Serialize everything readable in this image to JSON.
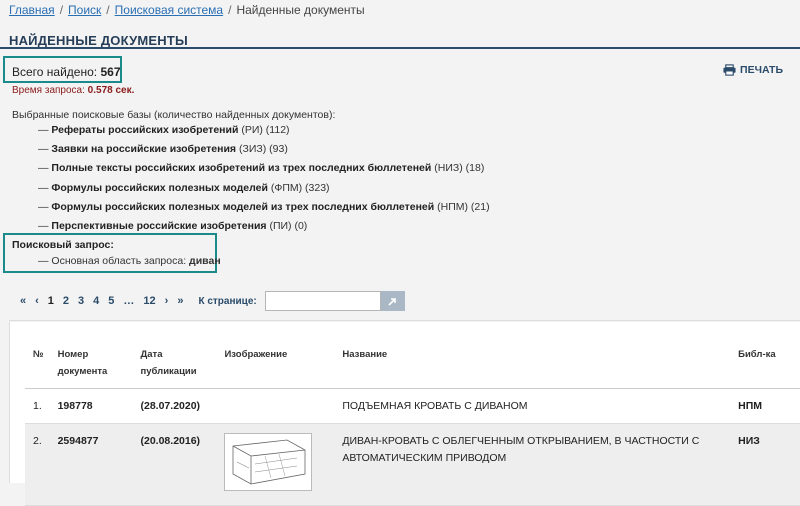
{
  "breadcrumb": {
    "home": "Главная",
    "search": "Поиск",
    "system": "Поисковая система",
    "current": "Найденные документы"
  },
  "page": {
    "title": "НАЙДЕННЫЕ ДОКУМЕНТЫ"
  },
  "summary": {
    "total_label": "Всего найдено:",
    "total_value": "567",
    "time_label": "Время запроса:",
    "time_value": "0.578 сек."
  },
  "print_label": "ПЕЧАТЬ",
  "databases": {
    "heading": "Выбранные поисковые базы (количество найденных документов):",
    "items": [
      {
        "name": "Рефераты российских изобретений",
        "count": "(РИ) (112)"
      },
      {
        "name": "Заявки на российские изобретения",
        "count": "(ЗИЗ) (93)"
      },
      {
        "name": "Полные тексты российских изобретений из трех последних бюллетеней",
        "count": "(НИЗ) (18)"
      },
      {
        "name": "Формулы российских полезных моделей",
        "count": "(ФПМ) (323)"
      },
      {
        "name": "Формулы российских полезных моделей из трех последних бюллетеней",
        "count": "(НПМ) (21)"
      },
      {
        "name": "Перспективные российские изобретения",
        "count": "(ПИ) (0)"
      }
    ]
  },
  "query": {
    "title": "Поисковый запрос:",
    "label": "— Основная область запроса:",
    "value": "диван"
  },
  "pagination": {
    "first": "«",
    "prev": "‹",
    "pages": [
      "1",
      "2",
      "3",
      "4",
      "5"
    ],
    "ellipsis": "…",
    "last_page": "12",
    "next": "›",
    "last": "»",
    "goto_label": "К странице:",
    "current": "1"
  },
  "table": {
    "headers": {
      "idx": "№",
      "number": "Номер документа",
      "date": "Дата публикации",
      "image": "Изображение",
      "name": "Название",
      "lib": "Библ-ка"
    },
    "rows": [
      {
        "idx": "1.",
        "number": "198778",
        "date": "(28.07.2020)",
        "name": "ПОДЪЕМНАЯ КРОВАТЬ С ДИВАНОМ",
        "lib": "НПМ"
      },
      {
        "idx": "2.",
        "number": "2594877",
        "date": "(20.08.2016)",
        "name": "ДИВАН-КРОВАТЬ С ОБЛЕГЧЕННЫМ ОТКРЫВАНИЕМ, В ЧАСТНОСТИ С АВТОМАТИЧЕСКИМ ПРИВОДОМ",
        "lib": "НИЗ"
      }
    ]
  }
}
